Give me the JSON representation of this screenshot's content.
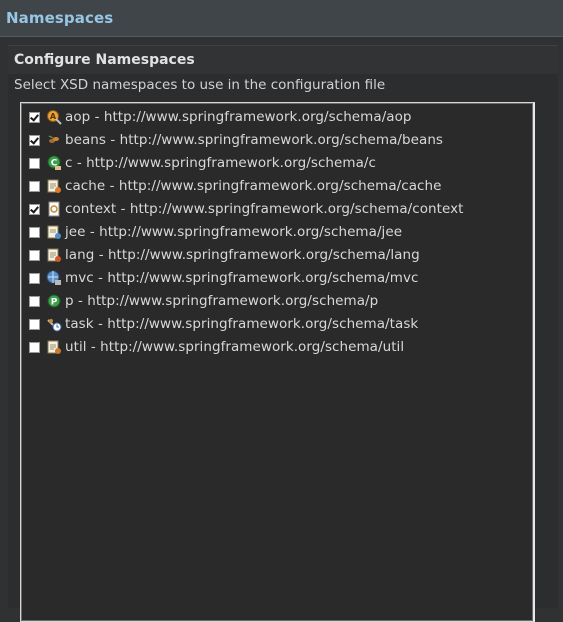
{
  "window": {
    "title": "Namespaces"
  },
  "section": {
    "title": "Configure Namespaces",
    "description": "Select XSD namespaces to use in the configuration file"
  },
  "namespaces": [
    {
      "label": "aop - http://www.springframework.org/schema/aop",
      "checked": true,
      "icon": "aop-icon"
    },
    {
      "label": "beans - http://www.springframework.org/schema/beans",
      "checked": true,
      "icon": "beans-icon"
    },
    {
      "label": "c - http://www.springframework.org/schema/c",
      "checked": false,
      "icon": "c-namespace-icon"
    },
    {
      "label": "cache - http://www.springframework.org/schema/cache",
      "checked": false,
      "icon": "cache-icon"
    },
    {
      "label": "context - http://www.springframework.org/schema/context",
      "checked": true,
      "icon": "context-icon"
    },
    {
      "label": "jee - http://www.springframework.org/schema/jee",
      "checked": false,
      "icon": "jee-icon"
    },
    {
      "label": "lang - http://www.springframework.org/schema/lang",
      "checked": false,
      "icon": "lang-icon"
    },
    {
      "label": "mvc - http://www.springframework.org/schema/mvc",
      "checked": false,
      "icon": "mvc-icon"
    },
    {
      "label": "p - http://www.springframework.org/schema/p",
      "checked": false,
      "icon": "p-namespace-icon"
    },
    {
      "label": "task - http://www.springframework.org/schema/task",
      "checked": false,
      "icon": "task-icon"
    },
    {
      "label": "util - http://www.springframework.org/schema/util",
      "checked": false,
      "icon": "util-icon"
    }
  ],
  "colors": {
    "title": "#97c6e4",
    "background": "#2f3133",
    "list_background": "#2a2a2a",
    "text": "#d8d8d8"
  }
}
